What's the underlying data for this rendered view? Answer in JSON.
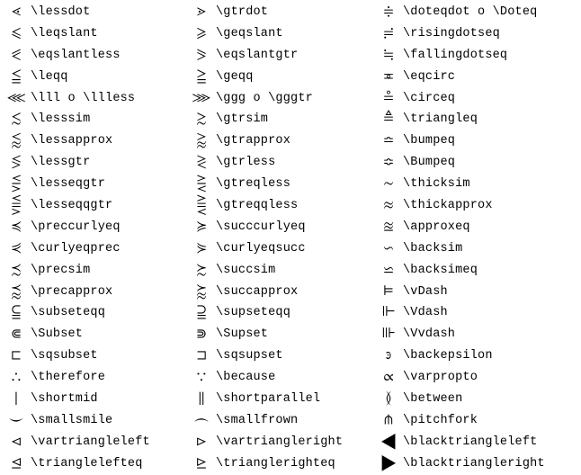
{
  "rows": [
    {
      "s1": "⋖",
      "c1": "\\lessdot",
      "s2": "⋗",
      "c2": "\\gtrdot",
      "s3": "≑",
      "c3": "\\doteqdot o \\Doteq"
    },
    {
      "s1": "⩽",
      "c1": "\\leqslant",
      "s2": "⩾",
      "c2": "\\geqslant",
      "s3": "≓",
      "c3": "\\risingdotseq"
    },
    {
      "s1": "⪕",
      "c1": "\\eqslantless",
      "s2": "⪖",
      "c2": "\\eqslantgtr",
      "s3": "≒",
      "c3": "\\fallingdotseq"
    },
    {
      "s1": "≦",
      "c1": "\\leqq",
      "s2": "≧",
      "c2": "\\geqq",
      "s3": "≖",
      "c3": "\\eqcirc"
    },
    {
      "s1": "⋘",
      "c1": "\\lll o \\llless",
      "s2": "⋙",
      "c2": "\\ggg o \\gggtr",
      "s3": "≗",
      "c3": "\\circeq"
    },
    {
      "s1": "≲",
      "c1": "\\lesssim",
      "s2": "≳",
      "c2": "\\gtrsim",
      "s3": "≜",
      "c3": "\\triangleq"
    },
    {
      "s1": "⪅",
      "c1": "\\lessapprox",
      "s2": "⪆",
      "c2": "\\gtrapprox",
      "s3": "≏",
      "c3": "\\bumpeq"
    },
    {
      "s1": "≶",
      "c1": "\\lessgtr",
      "s2": "≷",
      "c2": "\\gtrless",
      "s3": "≎",
      "c3": "\\Bumpeq"
    },
    {
      "s1": "⋚",
      "c1": "\\lesseqgtr",
      "s2": "⋛",
      "c2": "\\gtreqless",
      "s3": "∼",
      "c3": "\\thicksim"
    },
    {
      "s1": "⪋",
      "c1": "\\lesseqqgtr",
      "s2": "⪌",
      "c2": "\\gtreqqless",
      "s3": "≈",
      "c3": "\\thickapprox"
    },
    {
      "s1": "≼",
      "c1": "\\preccurlyeq",
      "s2": "≽",
      "c2": "\\succcurlyeq",
      "s3": "≊",
      "c3": "\\approxeq"
    },
    {
      "s1": "⋞",
      "c1": "\\curlyeqprec",
      "s2": "⋟",
      "c2": "\\curlyeqsucc",
      "s3": "∽",
      "c3": "\\backsim"
    },
    {
      "s1": "≾",
      "c1": "\\precsim",
      "s2": "≿",
      "c2": "\\succsim",
      "s3": "⋍",
      "c3": "\\backsimeq"
    },
    {
      "s1": "⪷",
      "c1": "\\precapprox",
      "s2": "⪸",
      "c2": "\\succapprox",
      "s3": "⊨",
      "c3": "\\vDash"
    },
    {
      "s1": "⫅",
      "c1": "\\subseteqq",
      "s2": "⫆",
      "c2": "\\supseteqq",
      "s3": "⊩",
      "c3": "\\Vdash"
    },
    {
      "s1": "⋐",
      "c1": "\\Subset",
      "s2": "⋑",
      "c2": "\\Supset",
      "s3": "⊪",
      "c3": "\\Vvdash"
    },
    {
      "s1": "⊏",
      "c1": "\\sqsubset",
      "s2": "⊐",
      "c2": "\\sqsupset",
      "s3": "϶",
      "c3": "\\backepsilon"
    },
    {
      "s1": "∴",
      "c1": "\\therefore",
      "s2": "∵",
      "c2": "\\because",
      "s3": "∝",
      "c3": "\\varpropto"
    },
    {
      "s1": "∣",
      "c1": "\\shortmid",
      "s2": "∥",
      "c2": "\\shortparallel",
      "s3": "≬",
      "c3": "\\between"
    },
    {
      "s1": "⌣",
      "c1": "\\smallsmile",
      "s2": "⌢",
      "c2": "\\smallfrown",
      "s3": "⋔",
      "c3": "\\pitchfork"
    },
    {
      "s1": "⊲",
      "c1": "\\vartriangleleft",
      "s2": "⊳",
      "c2": "\\vartriangleright",
      "s3": "◀",
      "c3": "\\blacktriangleleft"
    },
    {
      "s1": "⊴",
      "c1": "\\trianglelefteq",
      "s2": "⊵",
      "c2": "\\trianglerighteq",
      "s3": "▶",
      "c3": "\\blacktriangleright"
    }
  ]
}
